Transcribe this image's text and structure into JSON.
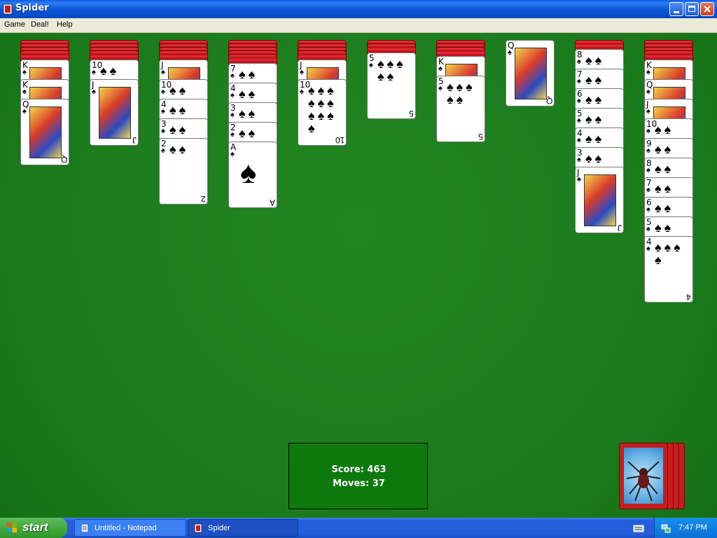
{
  "window": {
    "title": "Spider"
  },
  "menu": [
    "Game",
    "Deal!",
    "Help"
  ],
  "tableau": [
    {
      "hidden": 4,
      "cards": [
        {
          "rank": "K",
          "suit": "♠"
        },
        {
          "rank": "K",
          "suit": "♠"
        },
        {
          "rank": "Q",
          "suit": "♠"
        }
      ]
    },
    {
      "hidden": 4,
      "cards": [
        {
          "rank": "10",
          "suit": "♠"
        },
        {
          "rank": "J",
          "suit": "♠"
        }
      ]
    },
    {
      "hidden": 4,
      "cards": [
        {
          "rank": "J",
          "suit": "♠"
        },
        {
          "rank": "10",
          "suit": "♠"
        },
        {
          "rank": "4",
          "suit": "♠"
        },
        {
          "rank": "3",
          "suit": "♠"
        },
        {
          "rank": "2",
          "suit": "♠"
        }
      ]
    },
    {
      "hidden": 5,
      "cards": [
        {
          "rank": "7",
          "suit": "♠"
        },
        {
          "rank": "4",
          "suit": "♠"
        },
        {
          "rank": "3",
          "suit": "♠"
        },
        {
          "rank": "2",
          "suit": "♠"
        },
        {
          "rank": "A",
          "suit": "♠"
        }
      ]
    },
    {
      "hidden": 4,
      "cards": [
        {
          "rank": "J",
          "suit": "♠"
        },
        {
          "rank": "10",
          "suit": "♠"
        }
      ]
    },
    {
      "hidden": 2,
      "cards": [
        {
          "rank": "5",
          "suit": "♠"
        }
      ]
    },
    {
      "hidden": 3,
      "cards": [
        {
          "rank": "K",
          "suit": "♠"
        },
        {
          "rank": "5",
          "suit": "♠"
        }
      ]
    },
    {
      "hidden": 0,
      "cards": [
        {
          "rank": "Q",
          "suit": "♠"
        }
      ]
    },
    {
      "hidden": 1,
      "cards": [
        {
          "rank": "8",
          "suit": "♠"
        },
        {
          "rank": "7",
          "suit": "♠"
        },
        {
          "rank": "6",
          "suit": "♠"
        },
        {
          "rank": "5",
          "suit": "♠"
        },
        {
          "rank": "4",
          "suit": "♠"
        },
        {
          "rank": "3",
          "suit": "♠"
        },
        {
          "rank": "J",
          "suit": "♠"
        }
      ]
    },
    {
      "hidden": 4,
      "cards": [
        {
          "rank": "K",
          "suit": "♠"
        },
        {
          "rank": "Q",
          "suit": "♠"
        },
        {
          "rank": "J",
          "suit": "♠"
        },
        {
          "rank": "10",
          "suit": "♠"
        },
        {
          "rank": "9",
          "suit": "♠"
        },
        {
          "rank": "8",
          "suit": "♠"
        },
        {
          "rank": "7",
          "suit": "♠"
        },
        {
          "rank": "6",
          "suit": "♠"
        },
        {
          "rank": "5",
          "suit": "♠"
        },
        {
          "rank": "4",
          "suit": "♠"
        }
      ]
    }
  ],
  "score": {
    "score_label": "Score:",
    "score_value": "463",
    "moves_label": "Moves:",
    "moves_value": "37"
  },
  "stock": {
    "remaining_deals": 4
  },
  "taskbar": {
    "start_label": "start",
    "tasks": [
      {
        "label": "Untitled - Notepad"
      },
      {
        "label": "Spider"
      }
    ],
    "clock": "7:47 PM"
  }
}
